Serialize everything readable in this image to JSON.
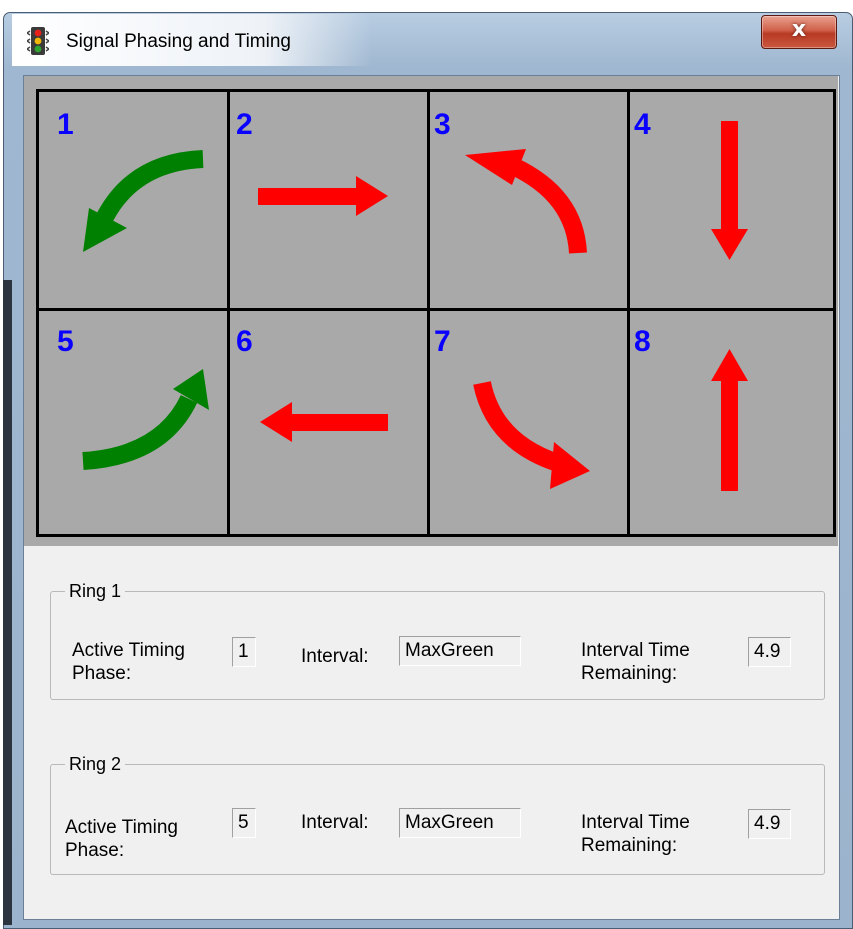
{
  "window": {
    "title": "Signal Phasing and Timing",
    "close_label": "x",
    "icon": "traffic-light-icon"
  },
  "phases": [
    {
      "number": "1",
      "movement": "left-turn",
      "color": "#008000",
      "state": "green"
    },
    {
      "number": "2",
      "movement": "through",
      "color": "#ff0000",
      "state": "red"
    },
    {
      "number": "3",
      "movement": "left-turn",
      "color": "#ff0000",
      "state": "red"
    },
    {
      "number": "4",
      "movement": "through",
      "color": "#ff0000",
      "state": "red"
    },
    {
      "number": "5",
      "movement": "left-turn",
      "color": "#008000",
      "state": "green"
    },
    {
      "number": "6",
      "movement": "through",
      "color": "#ff0000",
      "state": "red"
    },
    {
      "number": "7",
      "movement": "left-turn",
      "color": "#ff0000",
      "state": "red"
    },
    {
      "number": "8",
      "movement": "through",
      "color": "#ff0000",
      "state": "red"
    }
  ],
  "rings": [
    {
      "title": "Ring 1",
      "active_phase_label_1": "Active Timing",
      "active_phase_label_2": "Phase:",
      "active_phase_value": "1",
      "interval_label": "Interval:",
      "interval_value": "MaxGreen",
      "remaining_label_1": "Interval Time",
      "remaining_label_2": "Remaining:",
      "remaining_value": "4.9"
    },
    {
      "title": "Ring 2",
      "active_phase_label_1": "Active Timing",
      "active_phase_label_2": "Phase:",
      "active_phase_value": "5",
      "interval_label": "Interval:",
      "interval_value": "MaxGreen",
      "remaining_label_1": "Interval Time",
      "remaining_label_2": "Remaining:",
      "remaining_value": "4.9"
    }
  ],
  "colors": {
    "phase_number": "#0a00ff",
    "green_signal": "#008000",
    "red_signal": "#ff0000",
    "grid_background": "#a9a9a9"
  }
}
